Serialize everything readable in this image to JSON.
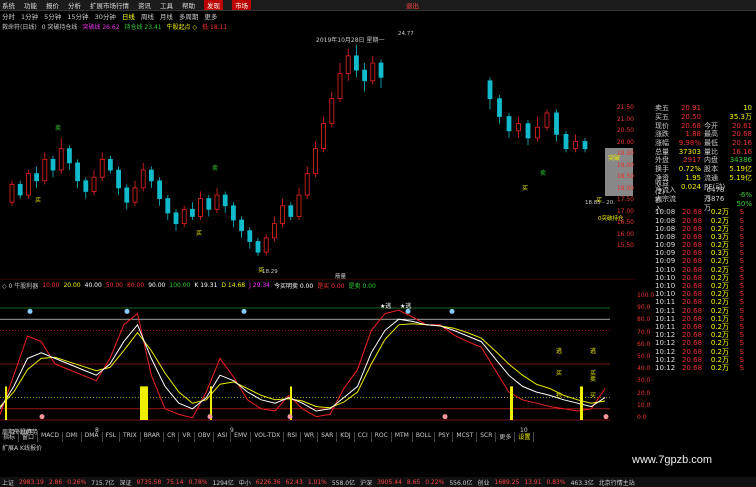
{
  "menu": {
    "items": [
      "系统",
      "功能",
      "报价",
      "分析",
      "扩展市场行情",
      "资讯",
      "工具",
      "帮助"
    ],
    "highlight": [
      "发现",
      "市场"
    ],
    "right_text": "退出"
  },
  "periods": [
    "分时",
    "1分钟",
    "5分钟",
    "15分钟",
    "30分钟",
    "日线",
    "周线",
    "月线",
    "多周期",
    "更多"
  ],
  "active_period": "日线",
  "main_legend": {
    "name": "救命符(日线)",
    "items": [
      {
        "text": "0 突破持仓线",
        "color": "#cccccc"
      },
      {
        "text": "突破线 26.62",
        "color": "#ee33ee"
      },
      {
        "text": "持仓线 23.41",
        "color": "#33cc33"
      },
      {
        "text": "牛股起点 ◇",
        "color": "#eeee00"
      },
      {
        "text": "低 18.11",
        "color": "#ff3333"
      }
    ]
  },
  "chart_labels": {
    "date": "2019年10月28日 星期一",
    "peak": "24.77",
    "low": "18.29",
    "open_box": "突破",
    "range_text": "18.85 - 20.",
    "right_label": "0突破持仓",
    "bottom_mid": "筋量",
    "buy_signals": [
      "买",
      "买",
      "买",
      "买",
      "买"
    ],
    "sell_signals": [
      "卖",
      "卖",
      "卖"
    ]
  },
  "price_axis": [
    "21.50",
    "21.00",
    "20.50",
    "20.00",
    "19.50",
    "19.00",
    "18.50",
    "18.00",
    "17.50",
    "17.00",
    "16.50",
    "16.00",
    "15.50"
  ],
  "quote_panel": {
    "rows": [
      {
        "k": "卖五",
        "v": "20.91",
        "vc": "#e33",
        "k2": "",
        "v2": "10",
        "v2c": "#ee0"
      },
      {
        "k": "买五",
        "v": "20.50",
        "vc": "#e33",
        "k2": "",
        "v2": "35.3万",
        "v2c": "#ee0"
      },
      {
        "k": "现价",
        "v": "20.68",
        "vc": "#e33",
        "k2": "今开",
        "v2": "20.61",
        "v2c": "#e33"
      },
      {
        "k": "涨跌",
        "v": "1.88",
        "vc": "#e33",
        "k2": "最高",
        "v2": "20.68",
        "v2c": "#e33"
      },
      {
        "k": "涨幅",
        "v": "9.98%",
        "vc": "#e33",
        "k2": "最低",
        "v2": "20.16",
        "v2c": "#e33"
      },
      {
        "k": "总量",
        "v": "37303",
        "vc": "#ee0",
        "k2": "量比",
        "v2": "16.16",
        "v2c": "#e33"
      },
      {
        "k": "外盘",
        "v": "2917",
        "vc": "#e33",
        "k2": "内盘",
        "v2": "34386",
        "v2c": "#3c3"
      },
      {
        "k": "换手",
        "v": "0.72%",
        "vc": "#ee0",
        "k2": "股本",
        "v2": "5.19亿",
        "v2c": "#ee0"
      },
      {
        "k": "净资",
        "v": "1.95",
        "vc": "#ee0",
        "k2": "流通",
        "v2": "5.19亿",
        "v2c": "#ee0"
      },
      {
        "k": "收益(2)",
        "v": "0.024",
        "vc": "#ee0",
        "k2": "PE(动)",
        "v2": "",
        "v2c": "#ee0"
      },
      {
        "k": "净流入额",
        "v": "",
        "vc": "#e33",
        "k2": "-6478万",
        "v2": "-6%",
        "v2c": "#3c3"
      },
      {
        "k": "大宗流入",
        "v": "",
        "vc": "#e33",
        "k2": "-3876万",
        "v2": "50%",
        "v2c": "#3c3"
      }
    ],
    "trades": [
      [
        "10:08",
        "20.68",
        "0.2万",
        "S"
      ],
      [
        "10:08",
        "20.68",
        "0.2万",
        "S"
      ],
      [
        "10:08",
        "20.68",
        "0.2万",
        "S"
      ],
      [
        "10:08",
        "20.68",
        "0.3万",
        "S"
      ],
      [
        "10:09",
        "20.68",
        "0.2万",
        "S"
      ],
      [
        "10:09",
        "20.68",
        "0.3万",
        "S"
      ],
      [
        "10:09",
        "20.68",
        "0.2万",
        "S"
      ],
      [
        "10:10",
        "20.68",
        "0.2万",
        "S"
      ],
      [
        "10:10",
        "20.68",
        "0.2万",
        "S"
      ],
      [
        "10:10",
        "20.68",
        "0.2万",
        "S"
      ],
      [
        "10:10",
        "20.68",
        "0.2万",
        "S"
      ],
      [
        "10:11",
        "20.68",
        "0.2万",
        "S"
      ],
      [
        "10:11",
        "20.68",
        "0.2万",
        "S"
      ],
      [
        "10:11",
        "20.68",
        "0.1万",
        "S"
      ],
      [
        "10:11",
        "20.68",
        "0.2万",
        "S"
      ],
      [
        "10:12",
        "20.68",
        "0.2万",
        "S"
      ],
      [
        "10:12",
        "20.68",
        "0.2万",
        "S"
      ],
      [
        "10:12",
        "20.68",
        "0.2万",
        "S"
      ],
      [
        "10:12",
        "20.68",
        "0.2万",
        "S"
      ],
      [
        "10:12",
        "20.68",
        "0.2万",
        "S"
      ]
    ]
  },
  "indicator_legend": [
    {
      "text": "◇ 0 牛股利器",
      "color": "#cccccc"
    },
    {
      "text": "10.00",
      "color": "#ff3333"
    },
    {
      "text": "20.00",
      "color": "#eeee00"
    },
    {
      "text": "40.00",
      "color": "#ffffff"
    },
    {
      "text": "50.00",
      "color": "#ff3333"
    },
    {
      "text": "80.00",
      "color": "#ff3333"
    },
    {
      "text": "90.00",
      "color": "#ffffff"
    },
    {
      "text": "100.00",
      "color": "#3c3"
    },
    {
      "text": "K 19.31",
      "color": "#ffffff"
    },
    {
      "text": "D 14.68",
      "color": "#eeee00"
    },
    {
      "text": "J 29.34",
      "color": "#ff33ff"
    },
    {
      "text": "今买明卖 0.00",
      "color": "#ffffff"
    },
    {
      "text": "是买 0.00",
      "color": "#ff3333"
    },
    {
      "text": "是卖 0.00",
      "color": "#3c3"
    }
  ],
  "indicator_axis": [
    "100.0",
    "90.0",
    "80.0",
    "70.0",
    "60.0",
    "50.0",
    "40.0",
    "30.0",
    "20.0",
    "10.0",
    "0.0"
  ],
  "indicator_labels": {
    "tops": [
      "★逃",
      "★逃"
    ],
    "marks": [
      "逃",
      "逃",
      "买",
      "买",
      "抄",
      "卖",
      "买"
    ]
  },
  "indicator_tabs": [
    "指标",
    "窗口",
    "MACD",
    "DMI",
    "DMA",
    "FSL",
    "TRIX",
    "BRAR",
    "CR",
    "VR",
    "OBV",
    "ASI",
    "EMV",
    "VOL-TDX",
    "RSI",
    "WR",
    "SAR",
    "KDJ",
    "CCI",
    "ROC",
    "MTM",
    "BOLL",
    "PSY",
    "MCST",
    "SCR",
    "更多",
    "设置"
  ],
  "active_indicator_tab": "设置",
  "bottom_info": {
    "left": "周期牛股趋势",
    "year": "2019年",
    "months": [
      "8",
      "9",
      "10"
    ],
    "row2": "扩展A  K线报价"
  },
  "status_bar": [
    {
      "text": "上证",
      "c": "#ccc"
    },
    {
      "text": "2983.19",
      "c": "#f44"
    },
    {
      "text": "2.86",
      "c": "#f44"
    },
    {
      "text": "0.26%",
      "c": "#f44"
    },
    {
      "text": "715.7亿",
      "c": "#ccc"
    },
    {
      "text": "深证",
      "c": "#ccc"
    },
    {
      "text": "9735.58",
      "c": "#f44"
    },
    {
      "text": "75.14",
      "c": "#f44"
    },
    {
      "text": "0.78%",
      "c": "#f44"
    },
    {
      "text": "1294亿",
      "c": "#ccc"
    },
    {
      "text": "中小",
      "c": "#ccc"
    },
    {
      "text": "6226.36",
      "c": "#f44"
    },
    {
      "text": "62.43",
      "c": "#f44"
    },
    {
      "text": "1.01%",
      "c": "#f44"
    },
    {
      "text": "558.0亿",
      "c": "#ccc"
    },
    {
      "text": "沪深",
      "c": "#ccc"
    },
    {
      "text": "3905.44",
      "c": "#f44"
    },
    {
      "text": "8.65",
      "c": "#f44"
    },
    {
      "text": "0.22%",
      "c": "#f44"
    },
    {
      "text": "556.0亿",
      "c": "#ccc"
    },
    {
      "text": "创业",
      "c": "#ccc"
    },
    {
      "text": "1689.25",
      "c": "#f44"
    },
    {
      "text": "13.91",
      "c": "#f44"
    },
    {
      "text": "0.83%",
      "c": "#f44"
    },
    {
      "text": "463.3亿",
      "c": "#ccc"
    },
    {
      "text": "北京行情主站",
      "c": "#ccc"
    }
  ],
  "watermark": "www.7gpzb.com"
}
